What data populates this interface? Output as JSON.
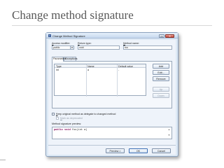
{
  "slide": {
    "title": "Change method signature"
  },
  "dialog": {
    "title": "Change Method Signature",
    "max_symbol": "▭",
    "close_symbol": "✕",
    "access_modifier": {
      "label": "Access modifier:",
      "value": "public"
    },
    "return_type": {
      "label": "Return type:",
      "value": "void"
    },
    "method_name": {
      "label": "Method name:",
      "value": "foo"
    },
    "tabs": [
      {
        "label": "Parameters",
        "active": true
      },
      {
        "label": "Exceptions",
        "active": false
      }
    ],
    "table": {
      "columns": [
        "Type",
        "Name",
        "Default value"
      ],
      "rows": [
        [
          "int",
          "a",
          "-"
        ]
      ]
    },
    "side_buttons": [
      {
        "label": "Add",
        "enabled": true
      },
      {
        "label": "Edit...",
        "enabled": true
      },
      {
        "label": "Remove",
        "enabled": true
      },
      {
        "label": "Up",
        "enabled": false
      },
      {
        "label": "Down",
        "enabled": false
      }
    ],
    "keep_delegate": {
      "label": "Keep original method as delegate to changed method",
      "checked": false
    },
    "mark_deprecated": {
      "label": "Mark as deprecated",
      "checked": false
    },
    "preview": {
      "label": "Method signature preview:",
      "code_keywords": "public void",
      "code_rest": "foo(int a)",
      "scroll_up": "▲",
      "scroll_down": "▼"
    },
    "footer_buttons": {
      "preview": "Preview >",
      "ok": "OK",
      "cancel": "Cancel"
    }
  },
  "colors": {
    "dialog_bg": "#dde9f5",
    "keyword": "#7f0055",
    "default_button_border": "#3d6fb5"
  }
}
